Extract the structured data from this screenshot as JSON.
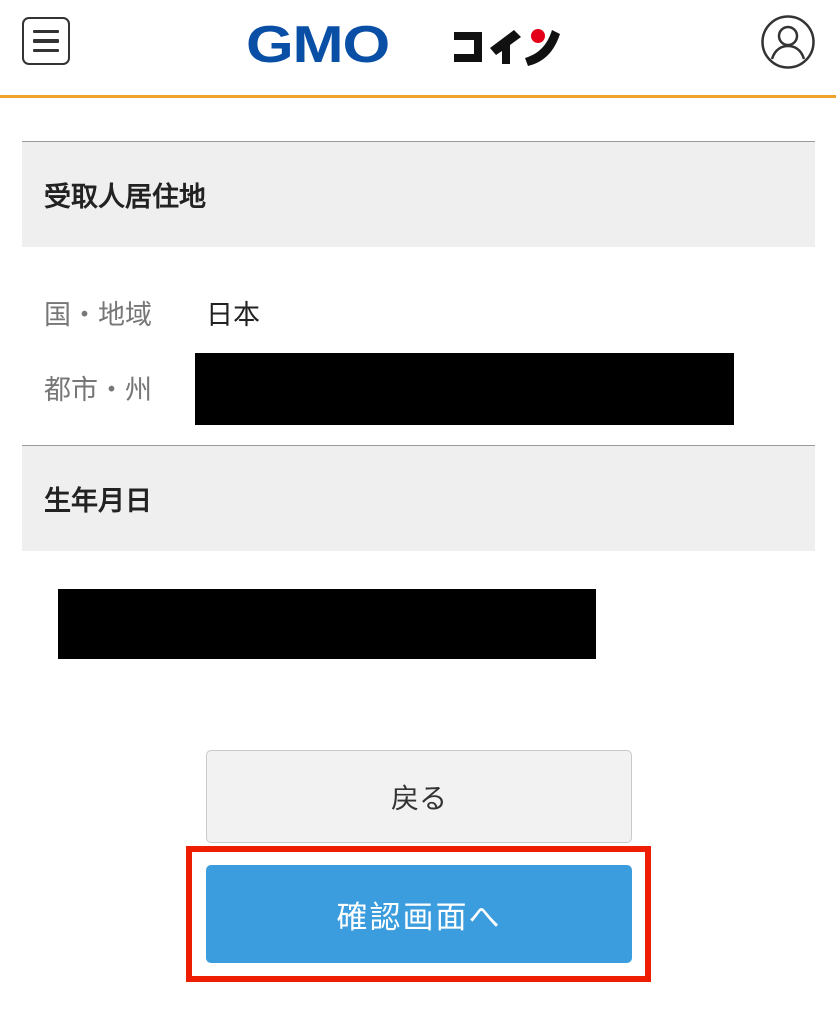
{
  "header": {
    "logo_text": "GMOコイン",
    "brand_colors": {
      "logo_blue": "#0a4fa6",
      "logo_dark": "#111111",
      "logo_red": "#e5001a",
      "accent_line": "#f0a32a"
    },
    "menu_icon": "hamburger-menu-icon",
    "user_icon": "user-account-icon"
  },
  "sections": {
    "recipient_address": {
      "title": "受取人居住地",
      "fields": [
        {
          "label": "国・地域",
          "value": "日本"
        },
        {
          "label": "都市・州",
          "value": ""
        }
      ]
    },
    "birthdate": {
      "title": "生年月日",
      "value": ""
    }
  },
  "buttons": {
    "back_label": "戻る",
    "confirm_label": "確認画面へ",
    "confirm_color": "#3b9ddd",
    "highlight_color": "#ee1c00"
  }
}
